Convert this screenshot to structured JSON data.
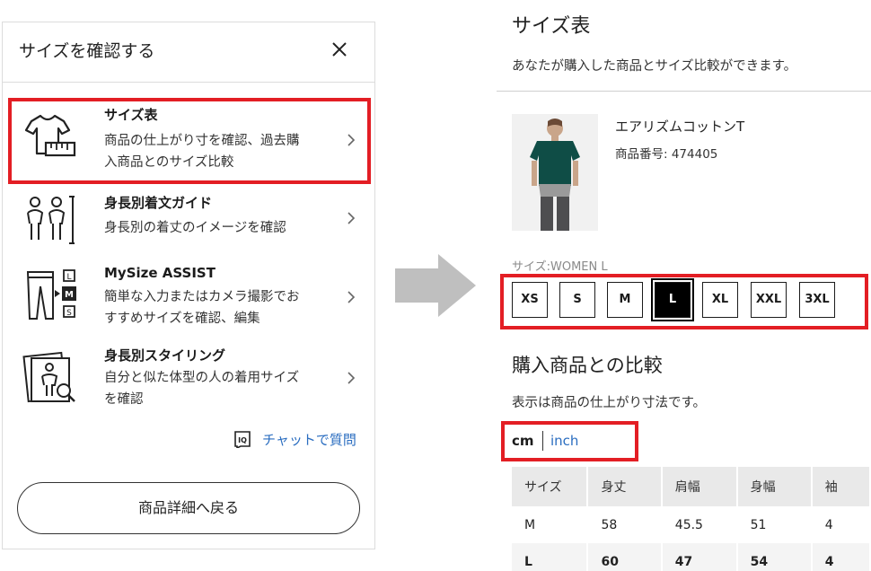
{
  "left_panel": {
    "title": "サイズを確認する",
    "items": [
      {
        "title": "サイズ表",
        "description": "商品の仕上がり寸を確認、過去購\n入商品とのサイズ比較"
      },
      {
        "title": "身長別着文ガイド",
        "description": "身長別の着丈のイメージを確認"
      },
      {
        "title": "MySize ASSIST",
        "description": "簡単な入力またはカメラ撮影でお\nすすめサイズを確認、編集"
      },
      {
        "title": "身長別スタイリング",
        "description": "自分と似た体型の人の着用サイズ\nを確認"
      }
    ],
    "chat_link": "チャットで質問",
    "back_button": "商品詳細へ戻る"
  },
  "right_panel": {
    "title": "サイズ表",
    "subtitle": "あなたが購入した商品とサイズ比較ができます。",
    "product": {
      "name": "エアリズムコットンT",
      "code": "商品番号: 474405"
    },
    "size_label": "サイズ:WOMEN L",
    "sizes": [
      "XS",
      "S",
      "M",
      "L",
      "XL",
      "XXL",
      "3XL"
    ],
    "selected_size": "L",
    "compare_title": "購入商品との比較",
    "compare_note": "表示は商品の仕上がり寸法です。",
    "units": {
      "cm": "cm",
      "inch": "inch",
      "active": "cm"
    },
    "table": {
      "headers": [
        "サイズ",
        "身丈",
        "肩幅",
        "身幅",
        "袖"
      ],
      "rows": [
        [
          "M",
          "58",
          "45.5",
          "51",
          "4"
        ],
        [
          "L",
          "60",
          "47",
          "54",
          "4"
        ]
      ]
    }
  },
  "colors": {
    "highlight": "#e31e24",
    "link": "#2a6dc0",
    "product_shirt": "#0f4d46"
  }
}
